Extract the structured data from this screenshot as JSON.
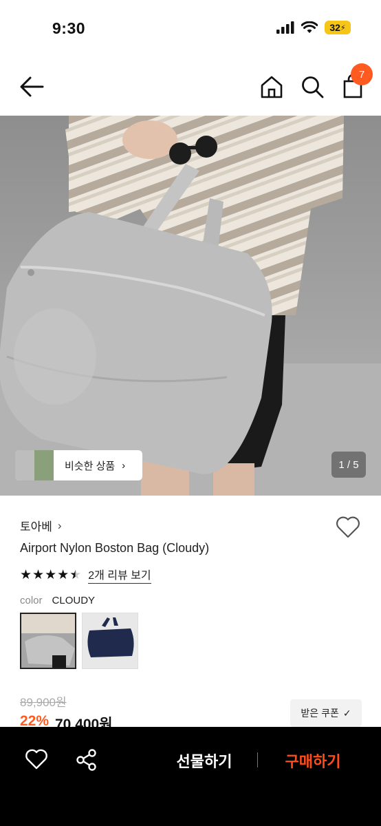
{
  "status_bar": {
    "time": "9:30",
    "battery": "32",
    "icons": [
      "signal-icon",
      "wifi-icon",
      "battery-icon"
    ]
  },
  "nav": {
    "icons": [
      "back-arrow-icon",
      "home-icon",
      "search-icon",
      "shopping-bag-icon"
    ],
    "cart_count": "7",
    "badge_color": "#ff5a1f"
  },
  "gallery": {
    "similar_label": "비슷한 상품",
    "counter": "1 / 5"
  },
  "product": {
    "brand": "토아베",
    "name": "Airport Nylon Boston Bag (Cloudy)",
    "rating_stars": 4.5,
    "review_link": "2개 리뷰 보기",
    "option_key": "color",
    "option_value": "CLOUDY",
    "swatches": [
      "cloudy-swatch",
      "navy-swatch"
    ],
    "original_price": "89,900원",
    "discount": "22%",
    "price": "70,400원",
    "coupon_label": "받은 쿠폰"
  },
  "bottom_bar": {
    "gift_label": "선물하기",
    "buy_label": "구매하기",
    "buy_color": "#ff4d1a"
  }
}
